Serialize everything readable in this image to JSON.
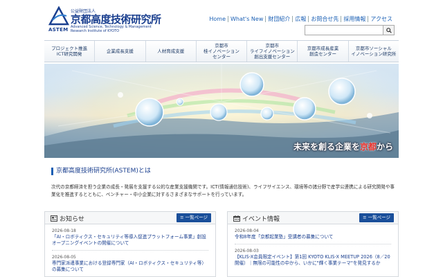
{
  "header": {
    "logo": {
      "mark_text": "ASTEM",
      "sub": "公益財団法人",
      "main": "京都高度技術研究所",
      "en_line1": "Advanced Science, Technology & Management",
      "en_line2": "Research Institute of KYOTO"
    },
    "topnav": [
      "Home",
      "What's New",
      "財団紹介",
      "広報",
      "お問合せ先",
      "採用情報",
      "アクセス"
    ],
    "search": {
      "value": "",
      "placeholder": ""
    }
  },
  "mainnav": [
    "プロジェクト推進\nICT研究開発",
    "企業成長支援",
    "人材育成支援",
    "京都市\n桂イノベーション\nセンター",
    "京都市\nライフイノベーション\n創出支援センター",
    "京都市成長産業\n創造センター",
    "京都市ソーシャル\nイノベーション研究所"
  ],
  "hero": {
    "caption_prefix": "未来を創る企業を",
    "caption_accent": "京都",
    "caption_suffix": "から"
  },
  "about": {
    "title": "京都高度技術研究所(ASTEM)とは",
    "text": "次代の京都経済を担う企業の成長・発展を支援する公的な産業支援機関です。ICT(情報通信技術)、ライフサイエンス、環境等の諸分野で産学公連携による研究開発や事業化を推進するとともに、ベンチャー・中小企業に対するさまざまなサポートを行っています。"
  },
  "news": {
    "title": "お知らせ",
    "list_button": "一覧ページ",
    "items": [
      {
        "date": "2026-08-18",
        "title": "「AI・ロボティクス・セキュリティ等導入促進プラットフォーム事業」創設オープニングイベントの開催について"
      },
      {
        "date": "2026-08-05",
        "title": "専門家派遣事業における登録専門家（AI・ロボティクス・セキュリティ等）の募集について"
      }
    ]
  },
  "events": {
    "title": "イベント情報",
    "list_button": "一覧ページ",
    "items": [
      {
        "date": "2026-08-04",
        "title": "令和8年度「京都起業塾」受講者の募集について"
      },
      {
        "date": "2026-08-03",
        "title": "【KLIS-X会員限定イベント】第1回 KYOTO KLIS-X MEETUP 2026（8／20開催）｜無限の可能性の中から、いかに\"輝く事業テーマ\"を発見するか"
      }
    ]
  },
  "colors": {
    "brand": "#1a3f8f",
    "link": "#1a5fb4",
    "button": "#1a4f9a",
    "accent": "#e8302a"
  }
}
